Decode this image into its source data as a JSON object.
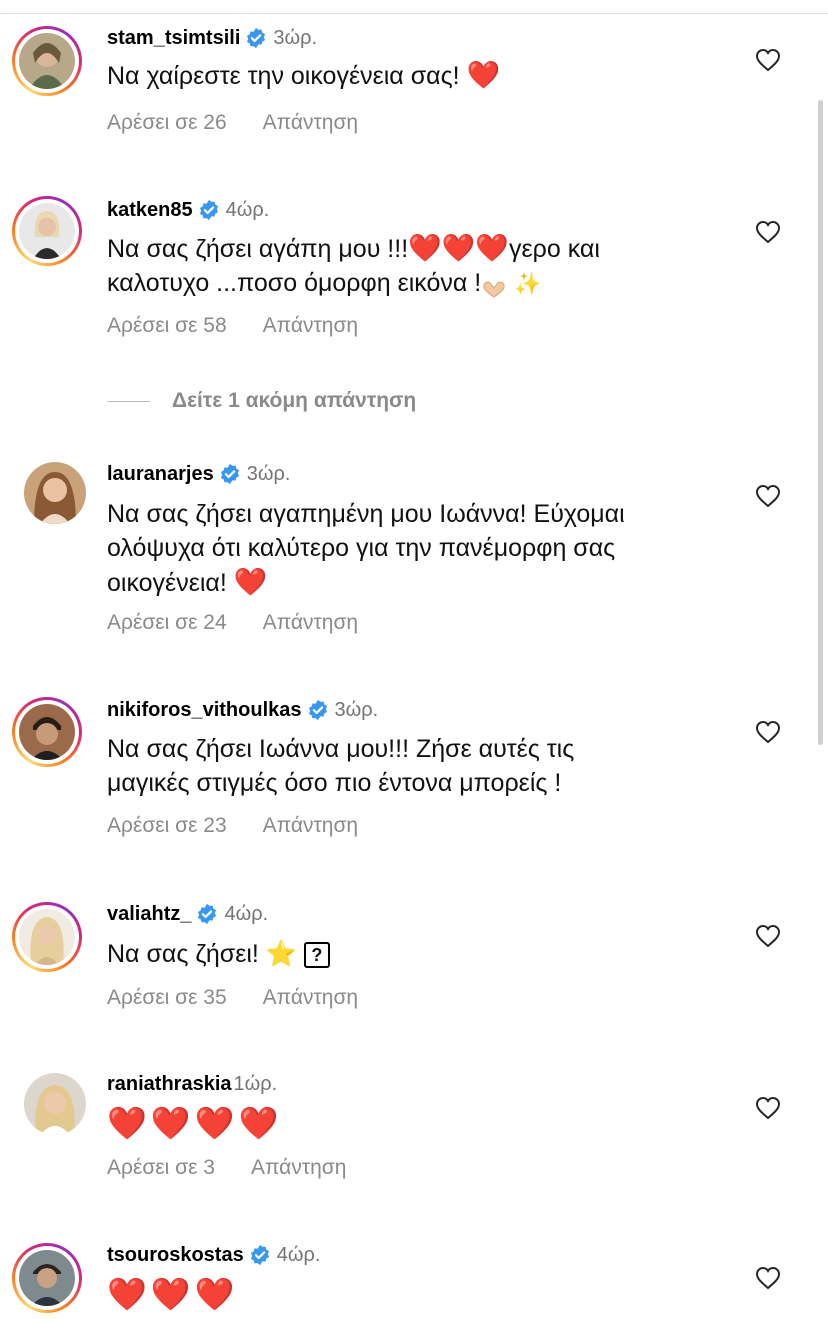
{
  "comments": [
    {
      "username": "stam_tsimtsili",
      "verified": true,
      "time": "3ώρ.",
      "text": "Να χαίρεστε την οικογένεια σας! ",
      "emoji": "❤️",
      "likes": "Αρέσει σε 26",
      "reply": "Απάντηση"
    },
    {
      "username": "katken85",
      "verified": true,
      "time": "4ώρ.",
      "text_line1": "Να σας ζήσει αγάπη μου !!!",
      "hearts": "❤️❤️❤️",
      "text_line1_end": "γερο και",
      "text_line2": "καλοτυχο ...ποσο όμορφη εικόνα !",
      "sparkles": "✨",
      "likes": "Αρέσει σε 58",
      "reply": "Απάντηση"
    },
    {
      "username": "lauranarjes",
      "verified": true,
      "time": "3ώρ.",
      "text_line1": "Να σας ζήσει αγαπημένη μου Ιωάννα! Εύχομαι",
      "text_line2": "ολόψυχα ότι καλύτερο για την πανέμορφη σας",
      "text_line3": "οικογένεια! ",
      "emoji": "❤️",
      "likes": "Αρέσει σε 24",
      "reply": "Απάντηση"
    },
    {
      "username": "nikiforos_vithoulkas",
      "verified": true,
      "time": "3ώρ.",
      "text_line1": "Να σας ζήσει Ιωάννα μου!!! Ζήσε αυτές τις",
      "text_line2": "μαγικές στιγμές όσο πιο έντονα μπορείς !",
      "likes": "Αρέσει σε 23",
      "reply": "Απάντηση"
    },
    {
      "username": "valiahtz_",
      "verified": true,
      "time": "4ώρ.",
      "text": "Να σας ζήσει! ",
      "star": "⭐",
      "unknown_glyph": "?",
      "likes": "Αρέσει σε 35",
      "reply": "Απάντηση"
    },
    {
      "username": "raniathraskia",
      "verified": false,
      "time": "1ώρ.",
      "hearts": "❤️❤️❤️❤️",
      "likes": "Αρέσει σε 3",
      "reply": "Απάντηση"
    },
    {
      "username": "tsouroskostas",
      "verified": true,
      "time": "4ώρ.",
      "hearts": "❤️❤️❤️"
    }
  ],
  "more_replies": "Δείτε 1 ακόμη απάντηση",
  "colors": {
    "username": "#000000",
    "meta": "#8a8a8a",
    "verified": "#3897f0",
    "heart": "#e0151a"
  },
  "icons": {
    "like": "heart-outline-icon",
    "verified": "verified-badge-icon"
  }
}
